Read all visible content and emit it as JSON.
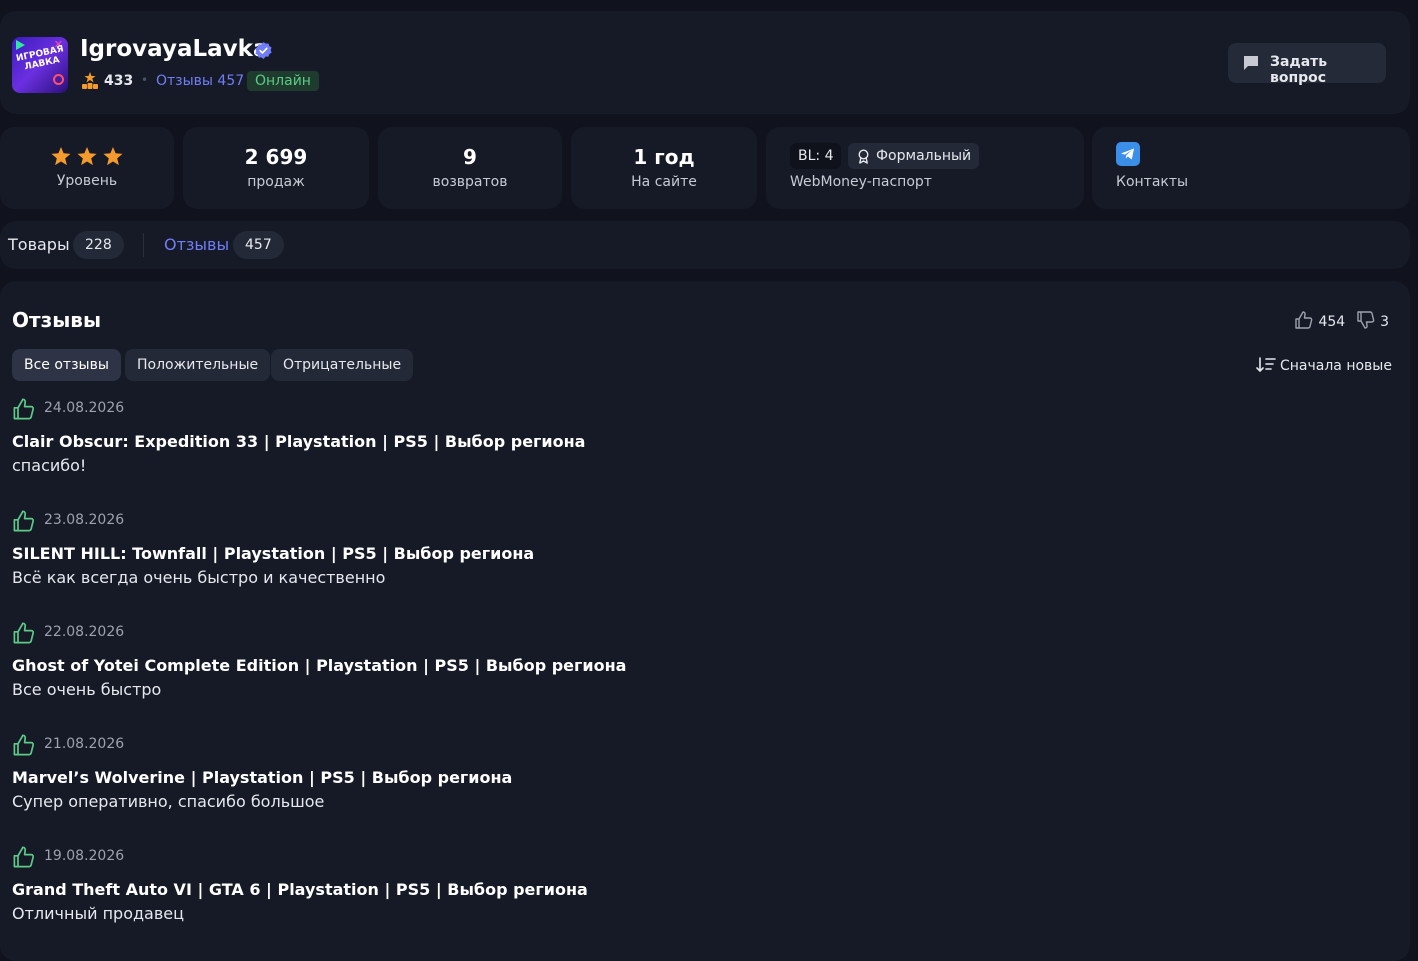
{
  "seller": {
    "name": "IgrovayaLavka",
    "rating": "433",
    "reviews_link": "Отзывы 457",
    "status": "Онлайн",
    "avatar_text": "ИГРОВАЯ ЛАВКА",
    "ask_button": "Задать вопрос"
  },
  "stats": {
    "level_label": "Уровень",
    "level_stars": 3,
    "sales_value": "2 699",
    "sales_label": "продаж",
    "returns_value": "9",
    "returns_label": "возвратов",
    "age_value": "1 год",
    "age_label": "На сайте",
    "bl_badge": "BL: 4",
    "formal_badge": "Формальный",
    "webmoney_label": "WebMoney-паспорт",
    "contacts_label": "Контакты"
  },
  "tabs": {
    "goods_label": "Товары",
    "goods_count": "228",
    "reviews_label": "Отзывы",
    "reviews_count": "457"
  },
  "reviews_section": {
    "title": "Отзывы",
    "likes": "454",
    "dislikes": "3",
    "filters": [
      "Все отзывы",
      "Положительные",
      "Отрицательные"
    ],
    "sort_label": "Сначала новые",
    "items": [
      {
        "date": "24.08.2026",
        "title": "Clair Obscur: Expedition 33 | Playstation | PS5 | Выбор региона",
        "text": "спасибо!"
      },
      {
        "date": "23.08.2026",
        "title": "SILENT HILL: Townfall | Playstation | PS5 | Выбор региона",
        "text": "Всё как всегда очень быстро и качественно"
      },
      {
        "date": "22.08.2026",
        "title": "Ghost of Yotei Complete Edition | Playstation | PS5 | Выбор региона",
        "text": "Все очень быстро"
      },
      {
        "date": "21.08.2026",
        "title": "Marvel’s Wolverine | Playstation | PS5 | Выбор региона",
        "text": "Супер оперативно, спасибо большое"
      },
      {
        "date": "19.08.2026",
        "title": "Grand Theft Auto VI | GTA 6 | Playstation | PS5 | Выбор региона",
        "text": "Отличный продавец"
      }
    ]
  },
  "colors": {
    "accent": "#6f7df6",
    "positive": "#5ccb86",
    "star": "#f59a2c",
    "background": "#10131d",
    "card": "#161a27"
  }
}
